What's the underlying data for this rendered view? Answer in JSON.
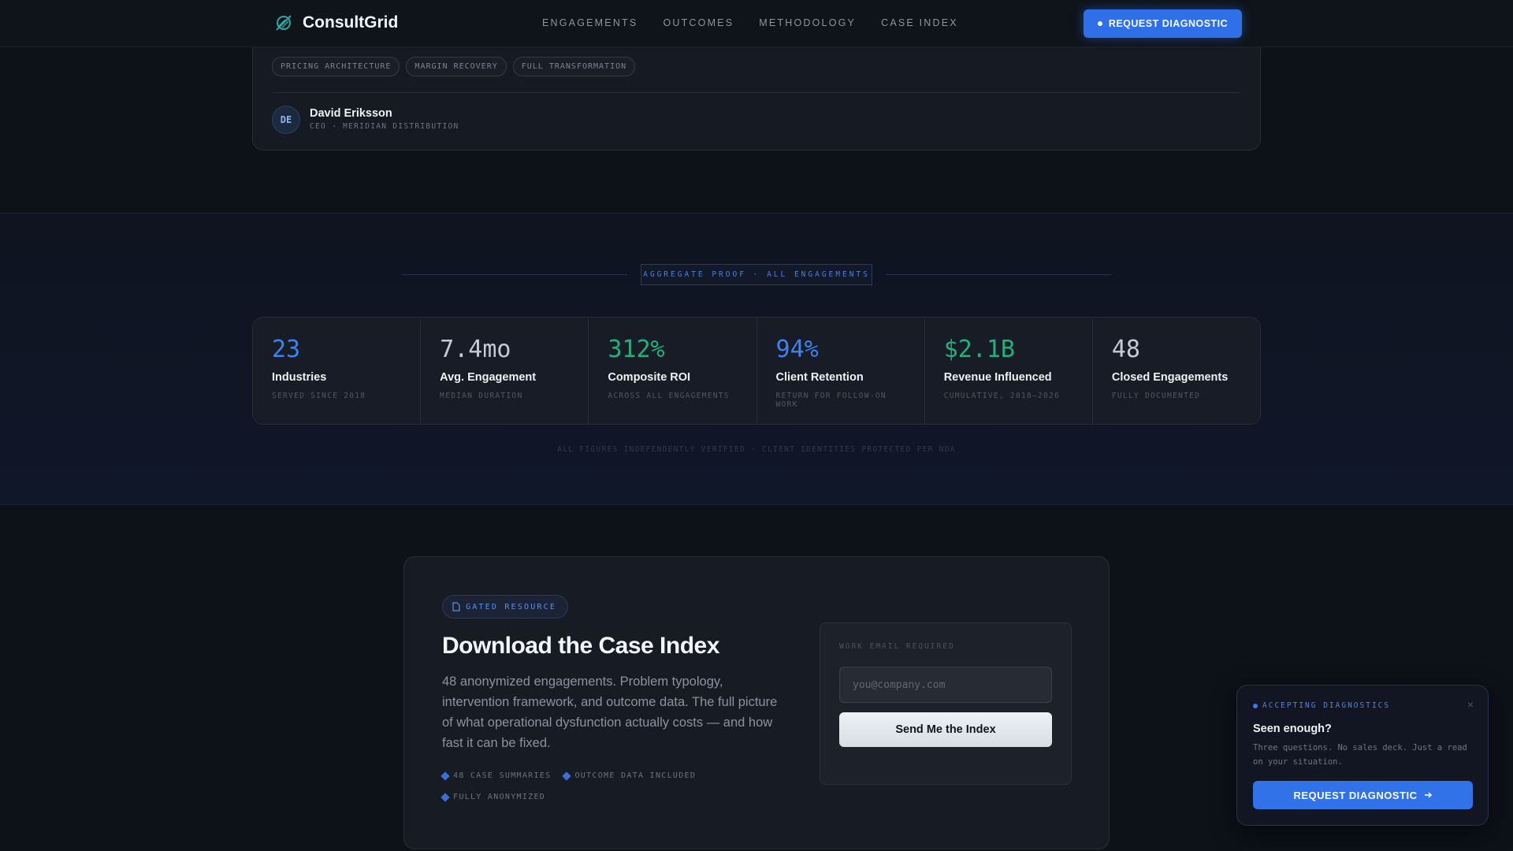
{
  "nav": {
    "brand": "ConsultGrid",
    "links": [
      "ENGAGEMENTS",
      "OUTCOMES",
      "METHODOLOGY",
      "CASE INDEX"
    ],
    "cta": "REQUEST DIAGNOSTIC"
  },
  "testimonial": {
    "tags": [
      "PRICING ARCHITECTURE",
      "MARGIN RECOVERY",
      "FULL TRANSFORMATION"
    ],
    "initials": "DE",
    "name": "David Eriksson",
    "role": "CEO · MERIDIAN DISTRIBUTION"
  },
  "proof": {
    "badge": "AGGREGATE PROOF · ALL ENGAGEMENTS",
    "stats": [
      {
        "value": "23",
        "label": "Industries",
        "sub": "SERVED SINCE 2018",
        "color": "#3b82f6"
      },
      {
        "value": "7.4mo",
        "label": "Avg. Engagement",
        "sub": "MEDIAN DURATION",
        "color": "#c5cad3"
      },
      {
        "value": "312%",
        "label": "Composite ROI",
        "sub": "ACROSS ALL ENGAGEMENTS",
        "color": "#22b07d"
      },
      {
        "value": "94%",
        "label": "Client Retention",
        "sub": "RETURN FOR FOLLOW-ON WORK",
        "color": "#3b82f6"
      },
      {
        "value": "$2.1B",
        "label": "Revenue Influenced",
        "sub": "CUMULATIVE, 2018–2026",
        "color": "#22b07d"
      },
      {
        "value": "48",
        "label": "Closed Engagements",
        "sub": "FULLY DOCUMENTED",
        "color": "#c5cad3"
      }
    ],
    "note": "ALL FIGURES INDEPENDENTLY VERIFIED · CLIENT IDENTITIES PROTECTED PER NDA"
  },
  "download": {
    "badge": "GATED RESOURCE",
    "title": "Download the Case Index",
    "description": "48 anonymized engagements. Problem typology, intervention framework, and outcome data. The full picture of what operational dysfunction actually costs — and how fast it can be fixed.",
    "features": [
      "48 CASE SUMMARIES",
      "OUTCOME DATA INCLUDED",
      "FULLY ANONYMIZED"
    ],
    "form_label": "WORK EMAIL REQUIRED",
    "email_value": "",
    "email_placeholder": "you@company.com",
    "submit": "Send Me the Index"
  },
  "popup": {
    "status": "ACCEPTING DIAGNOSTICS",
    "close": "×",
    "title": "Seen enough?",
    "text": "Three questions. No sales deck. Just a read on your situation.",
    "cta": "REQUEST DIAGNOSTIC"
  },
  "icons": {
    "brand": "slashed-circle-logo-icon",
    "gated": "document-icon",
    "feature": "diamond-icon",
    "arrow": "arrow-right-icon"
  },
  "colors": {
    "accent": "#2f6fe8",
    "green": "#22b07d",
    "background": "#0d1118"
  }
}
